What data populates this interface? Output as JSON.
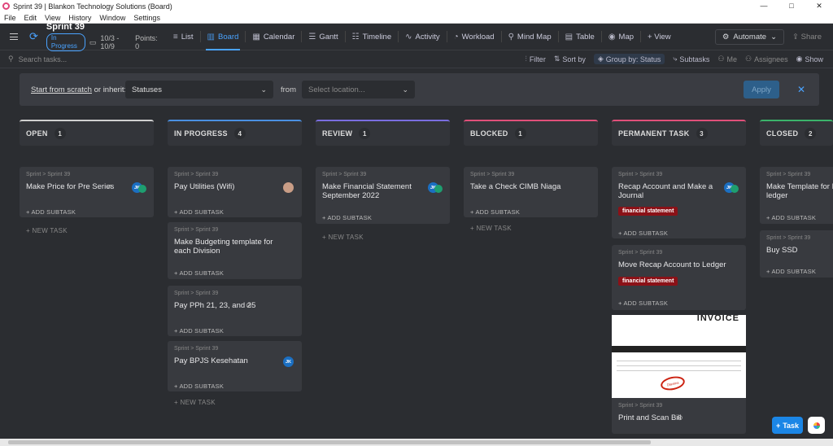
{
  "window": {
    "title": "Sprint 39 | Blankon Technology Solutions (Board)",
    "controls": [
      "—",
      "□",
      "✕"
    ]
  },
  "menu": [
    "File",
    "Edit",
    "View",
    "History",
    "Window",
    "Settings"
  ],
  "sprint": {
    "name": "Sprint 39",
    "status": "In Progress",
    "dates": "10/3 - 10/9",
    "points": "Points: 0"
  },
  "views": [
    {
      "label": "List",
      "icon": "≡"
    },
    {
      "label": "Board",
      "icon": "▥"
    },
    {
      "label": "Calendar",
      "icon": "▦"
    },
    {
      "label": "Gantt",
      "icon": "☰"
    },
    {
      "label": "Timeline",
      "icon": "☷"
    },
    {
      "label": "Activity",
      "icon": "∿"
    },
    {
      "label": "Workload",
      "icon": "◔"
    },
    {
      "label": "Mind Map",
      "icon": "⚲"
    },
    {
      "label": "Table",
      "icon": "▤"
    },
    {
      "label": "Map",
      "icon": "◉"
    },
    {
      "label": "+ View",
      "icon": ""
    }
  ],
  "toolbar_right": {
    "automate": "Automate",
    "share": "Share"
  },
  "search": {
    "placeholder": "Search tasks..."
  },
  "filters": {
    "filter": "Filter",
    "sort": "Sort by",
    "group": "Group by: Status",
    "subtasks": "Subtasks",
    "me": "Me",
    "assignees": "Assignees",
    "show": "Show"
  },
  "inherit": {
    "prefix": "Start from scratch",
    "suffix": "or inherit:",
    "statuses": "Statuses",
    "from": "from",
    "location_placeholder": "Select location...",
    "apply": "Apply"
  },
  "add_subtask": "+ ADD SUBTASK",
  "new_task": "+ NEW TASK",
  "breadcrumb": "Sprint  >  Sprint 39",
  "columns": [
    {
      "name": "OPEN",
      "count": "1",
      "color": "#d0d0d0",
      "cards": [
        {
          "title": "Make Price for Pre Series",
          "avatars": [
            "JK",
            "G"
          ]
        }
      ]
    },
    {
      "name": "IN PROGRESS",
      "count": "4",
      "color": "#4a90e2",
      "cards": [
        {
          "title": "Pay Utilities (Wifi)",
          "avatars": [
            "photo"
          ]
        },
        {
          "title": "Make Budgeting template for each Division"
        },
        {
          "title": "Pay PPh 21, 23, and 25"
        },
        {
          "title": "Pay BPJS Kesehatan",
          "avatars": [
            "JK"
          ]
        }
      ]
    },
    {
      "name": "REVIEW",
      "count": "1",
      "color": "#7a6ee0",
      "cards": [
        {
          "title": "Make Financial Statement September 2022",
          "avatars": [
            "JK",
            "G"
          ]
        }
      ]
    },
    {
      "name": "BLOCKED",
      "count": "1",
      "color": "#e0507a",
      "cards": [
        {
          "title": "Take a Check CIMB Niaga"
        }
      ]
    },
    {
      "name": "PERMANENT TASK",
      "count": "3",
      "color": "#e0507a",
      "cards": [
        {
          "title": "Recap Account and Make a Journal",
          "tag": "financial statement",
          "avatars": [
            "JK",
            "G"
          ]
        },
        {
          "title": "Move Recap Account to Ledger",
          "tag": "financial statement"
        },
        {
          "title": "Print and Scan Bill",
          "invoice_title": "INVOICE",
          "stamp": "Diterima"
        }
      ]
    },
    {
      "name": "CLOSED",
      "count": "2",
      "color": "#3bb36a",
      "cards": [
        {
          "title": "Make Template for Fi... general ledger"
        },
        {
          "title": "Buy SSD"
        }
      ]
    }
  ],
  "fab": {
    "label": "Task"
  }
}
